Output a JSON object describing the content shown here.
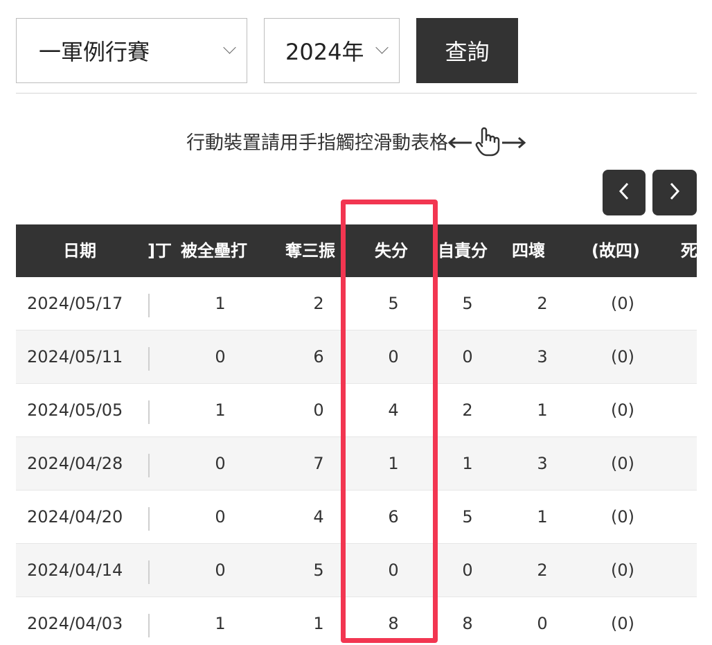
{
  "filters": {
    "type_select": "一軍例行賽",
    "year_select": "2024年",
    "query_button": "查詢"
  },
  "hint_text": "行動裝置請用手指觸控滑動表格",
  "columns": {
    "date": "日期",
    "partial": "]丁",
    "hr_allowed": "被全壘打",
    "strikeout": "奪三振",
    "runs": "失分",
    "earned_runs": "自責分",
    "walks": "四壞",
    "ibb": "(故四)",
    "next_partial": "死"
  },
  "rows": [
    {
      "date": "2024/05/17",
      "hr": "1",
      "so": "2",
      "r": "5",
      "er": "5",
      "bb": "2",
      "ibb": "(0)"
    },
    {
      "date": "2024/05/11",
      "hr": "0",
      "so": "6",
      "r": "0",
      "er": "0",
      "bb": "3",
      "ibb": "(0)"
    },
    {
      "date": "2024/05/05",
      "hr": "1",
      "so": "0",
      "r": "4",
      "er": "2",
      "bb": "1",
      "ibb": "(0)"
    },
    {
      "date": "2024/04/28",
      "hr": "0",
      "so": "7",
      "r": "1",
      "er": "1",
      "bb": "3",
      "ibb": "(0)"
    },
    {
      "date": "2024/04/20",
      "hr": "0",
      "so": "4",
      "r": "6",
      "er": "5",
      "bb": "1",
      "ibb": "(0)"
    },
    {
      "date": "2024/04/14",
      "hr": "0",
      "so": "5",
      "r": "0",
      "er": "0",
      "bb": "2",
      "ibb": "(0)"
    },
    {
      "date": "2024/04/03",
      "hr": "1",
      "so": "1",
      "r": "8",
      "er": "8",
      "bb": "0",
      "ibb": "(0)"
    }
  ],
  "colors": {
    "header_bg": "#333333",
    "highlight": "#f23651",
    "row_alt": "#f5f5f5"
  },
  "icons": [
    "chevron-down-icon",
    "left-arrow-icon",
    "pointing-hand-icon",
    "right-arrow-icon",
    "chevron-left-icon",
    "chevron-right-icon"
  ]
}
